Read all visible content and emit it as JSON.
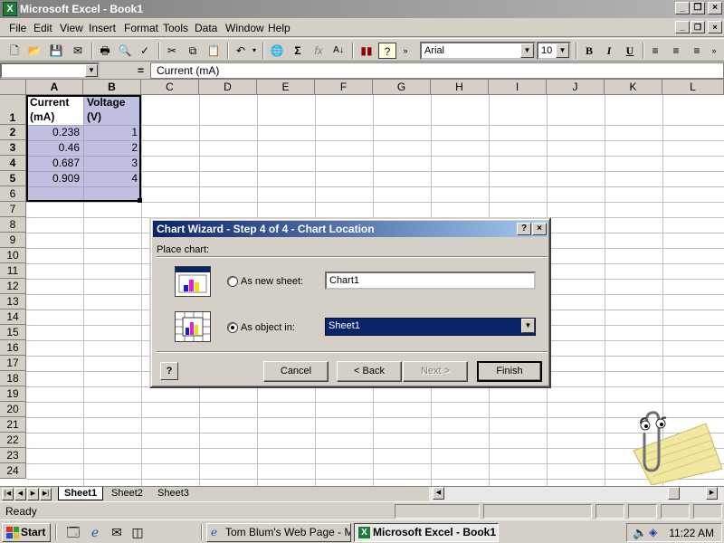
{
  "window": {
    "title": "Microsoft Excel - Book1",
    "app_icon": "excel-icon"
  },
  "menu": [
    "File",
    "Edit",
    "View",
    "Insert",
    "Format",
    "Tools",
    "Data",
    "Window",
    "Help"
  ],
  "toolbar": {
    "font_name": "Arial",
    "font_size": "10",
    "icons": [
      "new-icon",
      "open-icon",
      "save-icon",
      "mail-icon",
      "print-icon",
      "print-preview-icon",
      "spelling-icon",
      "cut-icon",
      "copy-icon",
      "paste-icon",
      "undo-icon",
      "web-icon",
      "autosum-icon",
      "function-icon",
      "sort-icon",
      "chart-wizard-icon",
      "help-icon",
      "bold-icon",
      "italic-icon",
      "underline-icon",
      "align-left-icon",
      "center-icon",
      "align-right-icon"
    ]
  },
  "formula_bar": {
    "name_box": "",
    "equals": "=",
    "content": "Current (mA)"
  },
  "grid": {
    "columns": [
      "A",
      "B",
      "C",
      "D",
      "E",
      "F",
      "G",
      "H",
      "I",
      "J",
      "K",
      "L"
    ],
    "rows": [
      "1",
      "2",
      "3",
      "4",
      "5",
      "6",
      "7",
      "8",
      "9",
      "10",
      "11",
      "12",
      "13",
      "14",
      "15",
      "16",
      "17",
      "18",
      "19",
      "20",
      "21",
      "22",
      "23",
      "24"
    ],
    "header_a": [
      "Current",
      "(mA)"
    ],
    "header_b": [
      "Voltage",
      "(V)"
    ],
    "data": [
      {
        "a": "0.238",
        "b": "1"
      },
      {
        "a": "0.46",
        "b": "2"
      },
      {
        "a": "0.687",
        "b": "3"
      },
      {
        "a": "0.909",
        "b": "4"
      }
    ]
  },
  "sheets": [
    "Sheet1",
    "Sheet2",
    "Sheet3"
  ],
  "status": "Ready",
  "dialog": {
    "title": "Chart Wizard - Step 4 of 4 - Chart Location",
    "place_label": "Place chart:",
    "option_new_sheet": "As new sheet:",
    "new_sheet_value": "Chart1",
    "option_object": "As object in:",
    "object_value": "Sheet1",
    "selected_option": "object",
    "buttons": {
      "cancel": "Cancel",
      "back": "< Back",
      "next": "Next >",
      "finish": "Finish"
    }
  },
  "taskbar": {
    "start": "Start",
    "tasks": [
      "Tom Blum's Web Page - M...",
      "Microsoft Excel - Book1"
    ],
    "active_task": "Microsoft Excel - Book1",
    "clock": "11:22 AM"
  }
}
